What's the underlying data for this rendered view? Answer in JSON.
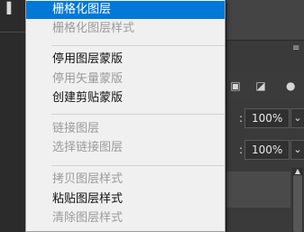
{
  "menu": {
    "groups": [
      {
        "items": [
          {
            "label": "栅格化图层",
            "state": "selected"
          },
          {
            "label": "栅格化图层样式",
            "state": "disabled"
          }
        ]
      },
      {
        "items": [
          {
            "label": "停用图层蒙版",
            "state": "enabled"
          },
          {
            "label": "停用矢量蒙版",
            "state": "disabled"
          },
          {
            "label": "创建剪贴蒙版",
            "state": "enabled"
          }
        ]
      },
      {
        "items": [
          {
            "label": "链接图层",
            "state": "disabled"
          },
          {
            "label": "选择链接图层",
            "state": "disabled"
          }
        ]
      },
      {
        "items": [
          {
            "label": "拷贝图层样式",
            "state": "disabled"
          },
          {
            "label": "粘贴图层样式",
            "state": "enabled"
          },
          {
            "label": "清除图层样式",
            "state": "disabled"
          }
        ]
      }
    ]
  },
  "layers_panel": {
    "opacity_value": "100%",
    "fill_value": "100%",
    "icons": {
      "menu": "panel-menu-icon",
      "transform": "transform-icon",
      "lock": "lock-icon",
      "brush": "brush-icon",
      "dropdown": "chevron-down-icon",
      "scroll_up": "scroll-up-icon"
    }
  },
  "colors": {
    "selection": "#0078d7",
    "menu_bg": "#f0f0f0",
    "disabled_text": "#9b9b9b",
    "app_bg": "#323232"
  }
}
